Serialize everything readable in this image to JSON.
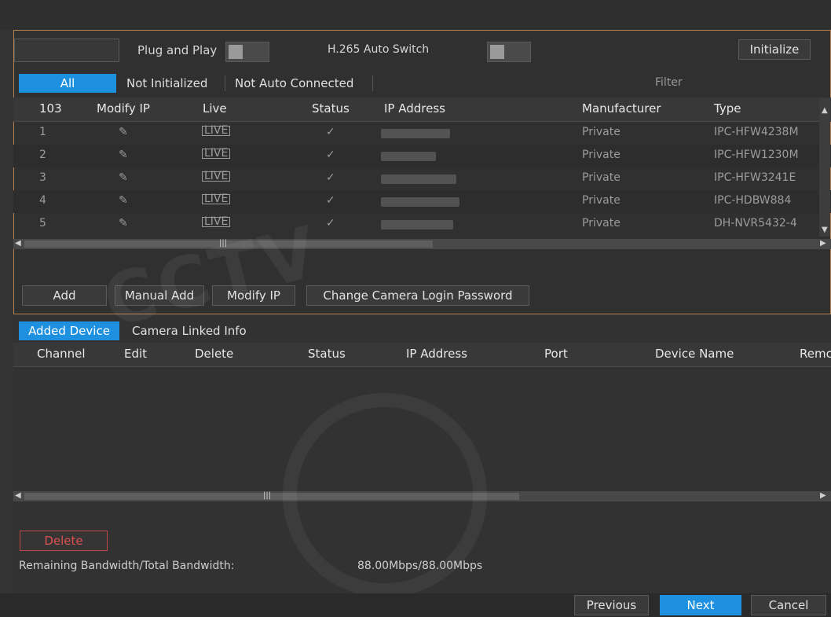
{
  "top": {
    "plug_and_play_label": "Plug and Play",
    "h265_label": "H.265 Auto Switch",
    "initialize_label": "Initialize"
  },
  "tabs": {
    "all": "All",
    "not_initialized": "Not Initialized",
    "not_auto_connected": "Not Auto Connected",
    "filter": "Filter"
  },
  "discovered": {
    "headers": [
      "103",
      "Modify IP",
      "Live",
      "Status",
      "IP Address",
      "Manufacturer",
      "Type"
    ],
    "rows": [
      {
        "no": "1",
        "manufacturer": "Private",
        "type": "IPC-HFW4238M"
      },
      {
        "no": "2",
        "manufacturer": "Private",
        "type": "IPC-HFW1230M"
      },
      {
        "no": "3",
        "manufacturer": "Private",
        "type": "IPC-HFW3241E"
      },
      {
        "no": "4",
        "manufacturer": "Private",
        "type": "IPC-HDBW884"
      },
      {
        "no": "5",
        "manufacturer": "Private",
        "type": "DH-NVR5432-4"
      }
    ],
    "live_badge": "LIVE"
  },
  "actions": {
    "add": "Add",
    "manual_add": "Manual Add",
    "modify_ip": "Modify IP",
    "change_password": "Change Camera Login Password"
  },
  "added_tabs": {
    "added_device": "Added Device",
    "camera_linked": "Camera Linked Info"
  },
  "added": {
    "headers": [
      "Channel",
      "Edit",
      "Delete",
      "Status",
      "IP Address",
      "Port",
      "Device Name",
      "Remc"
    ]
  },
  "bottom": {
    "delete_label": "Delete",
    "bandwidth_label": "Remaining Bandwidth/Total Bandwidth:",
    "bandwidth_value": "88.00Mbps/88.00Mbps"
  },
  "footer": {
    "previous": "Previous",
    "next": "Next",
    "cancel": "Cancel"
  },
  "colors": {
    "accent": "#1e90e0",
    "border_accent": "#b8814f",
    "ok": "#35c27c",
    "delete": "#e05050"
  }
}
